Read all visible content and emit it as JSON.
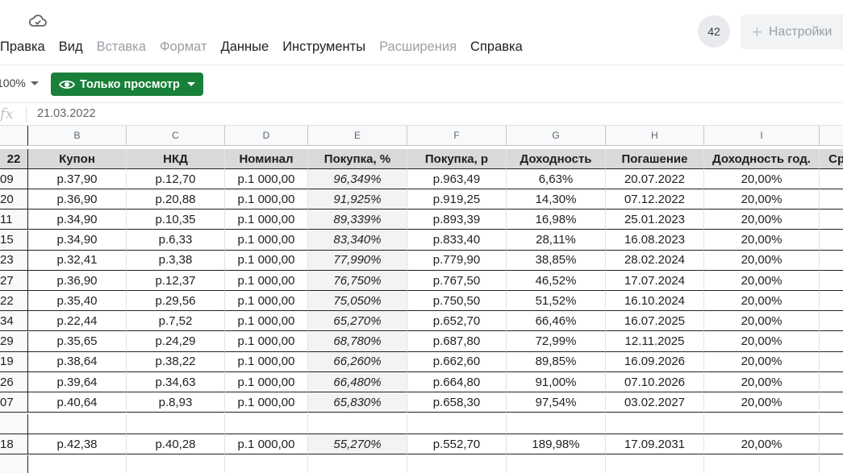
{
  "menu": [
    "Правка",
    "Вид",
    "Вставка",
    "Формат",
    "Данные",
    "Инструменты",
    "Расширения",
    "Справка"
  ],
  "menu_disabled": [
    false,
    false,
    true,
    true,
    false,
    false,
    true,
    false
  ],
  "avatar": "42",
  "settings_label": "Настройки",
  "zoom": "100%",
  "view_only_label": "Только просмотр",
  "formula": {
    "fx": "fx",
    "value": "21.03.2022"
  },
  "columns": [
    "",
    "B",
    "C",
    "D",
    "E",
    "F",
    "G",
    "H",
    "I",
    ""
  ],
  "header": [
    "22",
    "Купон",
    "НКД",
    "Номинал",
    "Покупка, %",
    "Покупка, р",
    "Доходность",
    "Погашение",
    "Доходность год.",
    "Срок"
  ],
  "rows": [
    [
      "09",
      "р.37,90",
      "р.12,70",
      "р.1 000,00",
      "96,349%",
      "р.963,49",
      "6,63%",
      "20.07.2022",
      "20,00%",
      ""
    ],
    [
      "20",
      "р.36,90",
      "р.20,88",
      "р.1 000,00",
      "91,925%",
      "р.919,25",
      "14,30%",
      "07.12.2022",
      "20,00%",
      ""
    ],
    [
      "11",
      "р.34,90",
      "р.10,35",
      "р.1 000,00",
      "89,339%",
      "р.893,39",
      "16,98%",
      "25.01.2023",
      "20,00%",
      ""
    ],
    [
      "15",
      "р.34,90",
      "р.6,33",
      "р.1 000,00",
      "83,340%",
      "р.833,40",
      "28,11%",
      "16.08.2023",
      "20,00%",
      ""
    ],
    [
      "23",
      "р.32,41",
      "р.3,38",
      "р.1 000,00",
      "77,990%",
      "р.779,90",
      "38,85%",
      "28.02.2024",
      "20,00%",
      ""
    ],
    [
      "27",
      "р.36,90",
      "р.12,37",
      "р.1 000,00",
      "76,750%",
      "р.767,50",
      "46,52%",
      "17.07.2024",
      "20,00%",
      ""
    ],
    [
      "22",
      "р.35,40",
      "р.29,56",
      "р.1 000,00",
      "75,050%",
      "р.750,50",
      "51,52%",
      "16.10.2024",
      "20,00%",
      ""
    ],
    [
      "34",
      "р.22,44",
      "р.7,52",
      "р.1 000,00",
      "65,270%",
      "р.652,70",
      "66,46%",
      "16.07.2025",
      "20,00%",
      ""
    ],
    [
      "29",
      "р.35,65",
      "р.24,29",
      "р.1 000,00",
      "68,780%",
      "р.687,80",
      "72,99%",
      "12.11.2025",
      "20,00%",
      ""
    ],
    [
      "19",
      "р.38,64",
      "р.38,22",
      "р.1 000,00",
      "66,260%",
      "р.662,60",
      "89,85%",
      "16.09.2026",
      "20,00%",
      ""
    ],
    [
      "26",
      "р.39,64",
      "р.34,63",
      "р.1 000,00",
      "66,480%",
      "р.664,80",
      "91,00%",
      "07.10.2026",
      "20,00%",
      ""
    ],
    [
      "07",
      "р.40,64",
      "р.8,93",
      "р.1 000,00",
      "65,830%",
      "р.658,30",
      "97,54%",
      "03.02.2027",
      "20,00%",
      ""
    ]
  ],
  "final_row": [
    "18",
    "р.42,38",
    "р.40,28",
    "р.1 000,00",
    "55,270%",
    "р.552,70",
    "189,98%",
    "17.09.2031",
    "20,00%",
    ""
  ]
}
